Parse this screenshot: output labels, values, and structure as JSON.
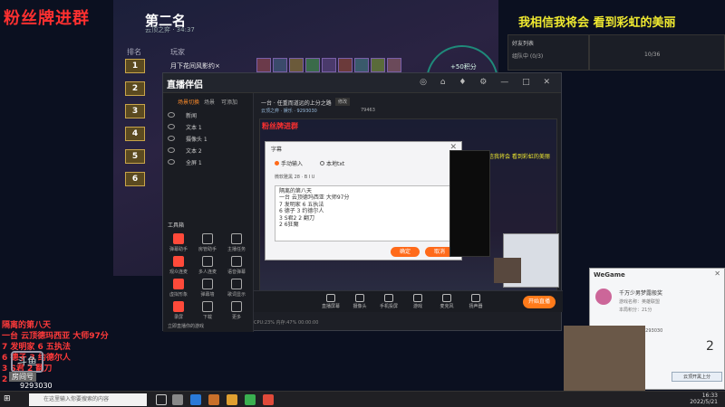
{
  "overlay": {
    "fan_group": "粉丝牌进群",
    "notes": [
      "隔离的第八天",
      "一台 云顶德玛西亚 大师97分",
      "7 发明家   6 五执法",
      "6 德子   3 约德尔人",
      "3 S君 2 翻刀",
      "2 6"
    ],
    "room_label": "房间号",
    "room_no": "9293030",
    "douyu_logo": "斗鱼"
  },
  "game": {
    "title": "第二名",
    "subtitle": "云顶之弈 · 34:37",
    "header_rank": "排名",
    "header_player": "玩家",
    "ranks": [
      "1",
      "2",
      "3",
      "4",
      "5",
      "6"
    ],
    "first_player": "月下花间风影约×",
    "reward": "+50积分"
  },
  "banner": "我相信我将会 看到彩虹的美丽",
  "right_panel": {
    "title": "好友列表",
    "row1": "组队中 (0/3)",
    "row1_value": "10/36"
  },
  "app": {
    "logo": "直播伴侣",
    "window_controls": "◎ ⌂ ♦ ⚙ — □ ✕",
    "tabs": [
      "场景切换",
      "场景",
      "可添加"
    ],
    "sources": [
      "新闻",
      "文本 1",
      "摄像头 1",
      "文本 2",
      "全屏 1"
    ],
    "toolbox_title": "工具箱",
    "tools": [
      "弹幕助手",
      "房管助手",
      "主播任务",
      "观众连麦",
      "多人连麦",
      "语音弹幕",
      "虚拟形象",
      "弹幕墙",
      "歌词显示",
      "录屏",
      "下载",
      "更多"
    ],
    "footer_note": "立即直播你的游戏",
    "stream_title": "一台 · 任重而道远的上分之路",
    "stream_tag": "修改",
    "stream_sub": "云顶之弈 · 娱乐 · 9293030",
    "stream_room": "79463",
    "preview_fan_group": "粉丝牌进群",
    "preview_banner": "我相信我将会 看到彩虹的美丽",
    "bottom_actions": [
      "直播屏幕",
      "摄像头",
      "手机投屏",
      "游戏",
      "麦克风",
      "扬声器"
    ],
    "start_live": "开始直播",
    "status": "CPU:23%  内存:47%  00:00:00"
  },
  "dialog": {
    "title": "字幕",
    "close": "✕",
    "radio_manual": "手动输入",
    "radio_file": "本地txt",
    "format_bar": "微软雅黑  28  ·  B  I  U",
    "text_lines": [
      "隔离的第八天",
      "一台 云顶德玛西亚 大师97分",
      "7 发明家   6 五执法",
      "6 德子   3 约德尔人",
      "3 S君2   2 翻刀",
      "2 6狂魔"
    ],
    "ok": "确定",
    "cancel": "取消"
  },
  "wegame": {
    "title": "WeGame",
    "close": "✕",
    "user_name": "千万少男梦露般奖",
    "line1": "游戏名称：英雄联盟",
    "line2": "本局积分：21分",
    "room": "9293030",
    "big_number": "2",
    "join_btn": "云顶开黑上分"
  },
  "taskbar": {
    "start": "⊞",
    "search_placeholder": "在这里输入你要搜索的内容",
    "time": "16:33",
    "date": "2022/5/21"
  }
}
